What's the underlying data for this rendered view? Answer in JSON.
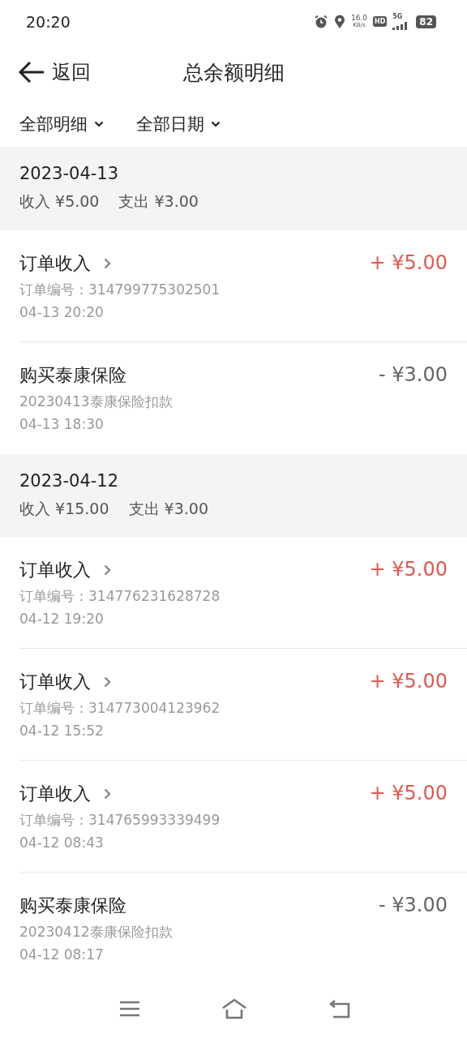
{
  "status_bar": {
    "time": "20:20",
    "net_speed": "16.0",
    "net_unit": "KB/s",
    "hd": "HD",
    "network": "5G",
    "battery": "82"
  },
  "header": {
    "back": "返回",
    "title": "总余额明细"
  },
  "filters": [
    {
      "label": "全部明细"
    },
    {
      "label": "全部日期"
    }
  ],
  "groups": [
    {
      "date": "2023-04-13",
      "income": "收入 ¥5.00",
      "expense": "支出 ¥3.00",
      "items": [
        {
          "kind": "order",
          "title": "订单收入",
          "detail": "订单编号：314799775302501",
          "time": "04-13 20:20",
          "amount": "+ ¥5.00"
        },
        {
          "kind": "payment",
          "title": "购买泰康保险",
          "detail": "20230413泰康保险扣款",
          "time": "04-13 18:30",
          "amount": "- ¥3.00"
        }
      ]
    },
    {
      "date": "2023-04-12",
      "income": "收入 ¥15.00",
      "expense": "支出 ¥3.00",
      "items": [
        {
          "kind": "order",
          "title": "订单收入",
          "detail": "订单编号：314776231628728",
          "time": "04-12 19:20",
          "amount": "+ ¥5.00"
        },
        {
          "kind": "order",
          "title": "订单收入",
          "detail": "订单编号：314773004123962",
          "time": "04-12 15:52",
          "amount": "+ ¥5.00"
        },
        {
          "kind": "order",
          "title": "订单收入",
          "detail": "订单编号：314765993339499",
          "time": "04-12 08:43",
          "amount": "+ ¥5.00"
        },
        {
          "kind": "payment",
          "title": "购买泰康保险",
          "detail": "20230412泰康保险扣款",
          "time": "04-12 08:17",
          "amount": "- ¥3.00"
        }
      ]
    }
  ]
}
